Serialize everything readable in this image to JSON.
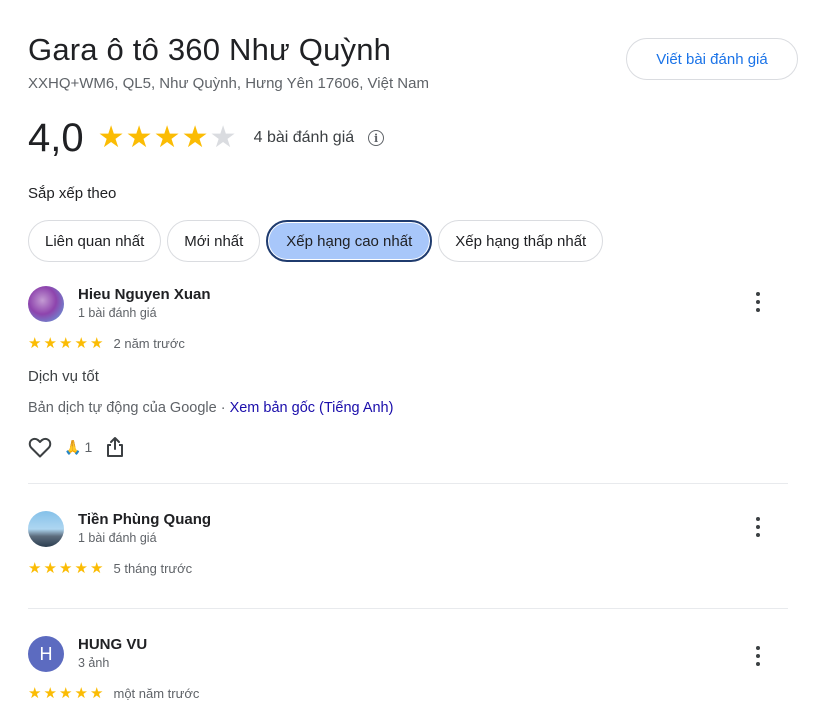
{
  "place": {
    "title": "Gara ô tô 360 Như Quỳnh",
    "address": "XXHQ+WM6, QL5, Như Quỳnh, Hưng Yên 17606, Việt Nam",
    "write_review_label": "Viết bài đánh giá",
    "rating": "4,0",
    "rating_value": 4,
    "review_count_label": "4 bài đánh giá",
    "info_icon": "info-icon"
  },
  "sort": {
    "label": "Sắp xếp theo",
    "options": [
      {
        "label": "Liên quan nhất",
        "active": false
      },
      {
        "label": "Mới nhất",
        "active": false
      },
      {
        "label": "Xếp hạng cao nhất",
        "active": true
      },
      {
        "label": "Xếp hạng thấp nhất",
        "active": false
      }
    ]
  },
  "reviews": [
    {
      "name": "Hieu Nguyen Xuan",
      "meta": "1 bài đánh giá",
      "stars": 5,
      "date": "2 năm trước",
      "text": "Dịch vụ tốt",
      "translation_note": "Bản dịch tự động của Google",
      "translation_sep": " · ",
      "translation_link": "Xem bản gốc (Tiếng Anh)",
      "reaction_emoji": "🙏",
      "reaction_count": "1"
    },
    {
      "name": "Tiền Phùng Quang",
      "meta": "1 bài đánh giá",
      "stars": 5,
      "date": "5 tháng trước"
    },
    {
      "name": "HUNG VU",
      "initial": "H",
      "meta": "3 ảnh",
      "stars": 5,
      "date": "một năm trước"
    }
  ],
  "colors": {
    "star": "#fbbc04",
    "star_empty": "#dadce0",
    "accent": "#1a73e8",
    "active_chip": "#a8c7fa",
    "link": "#1a0dab"
  }
}
